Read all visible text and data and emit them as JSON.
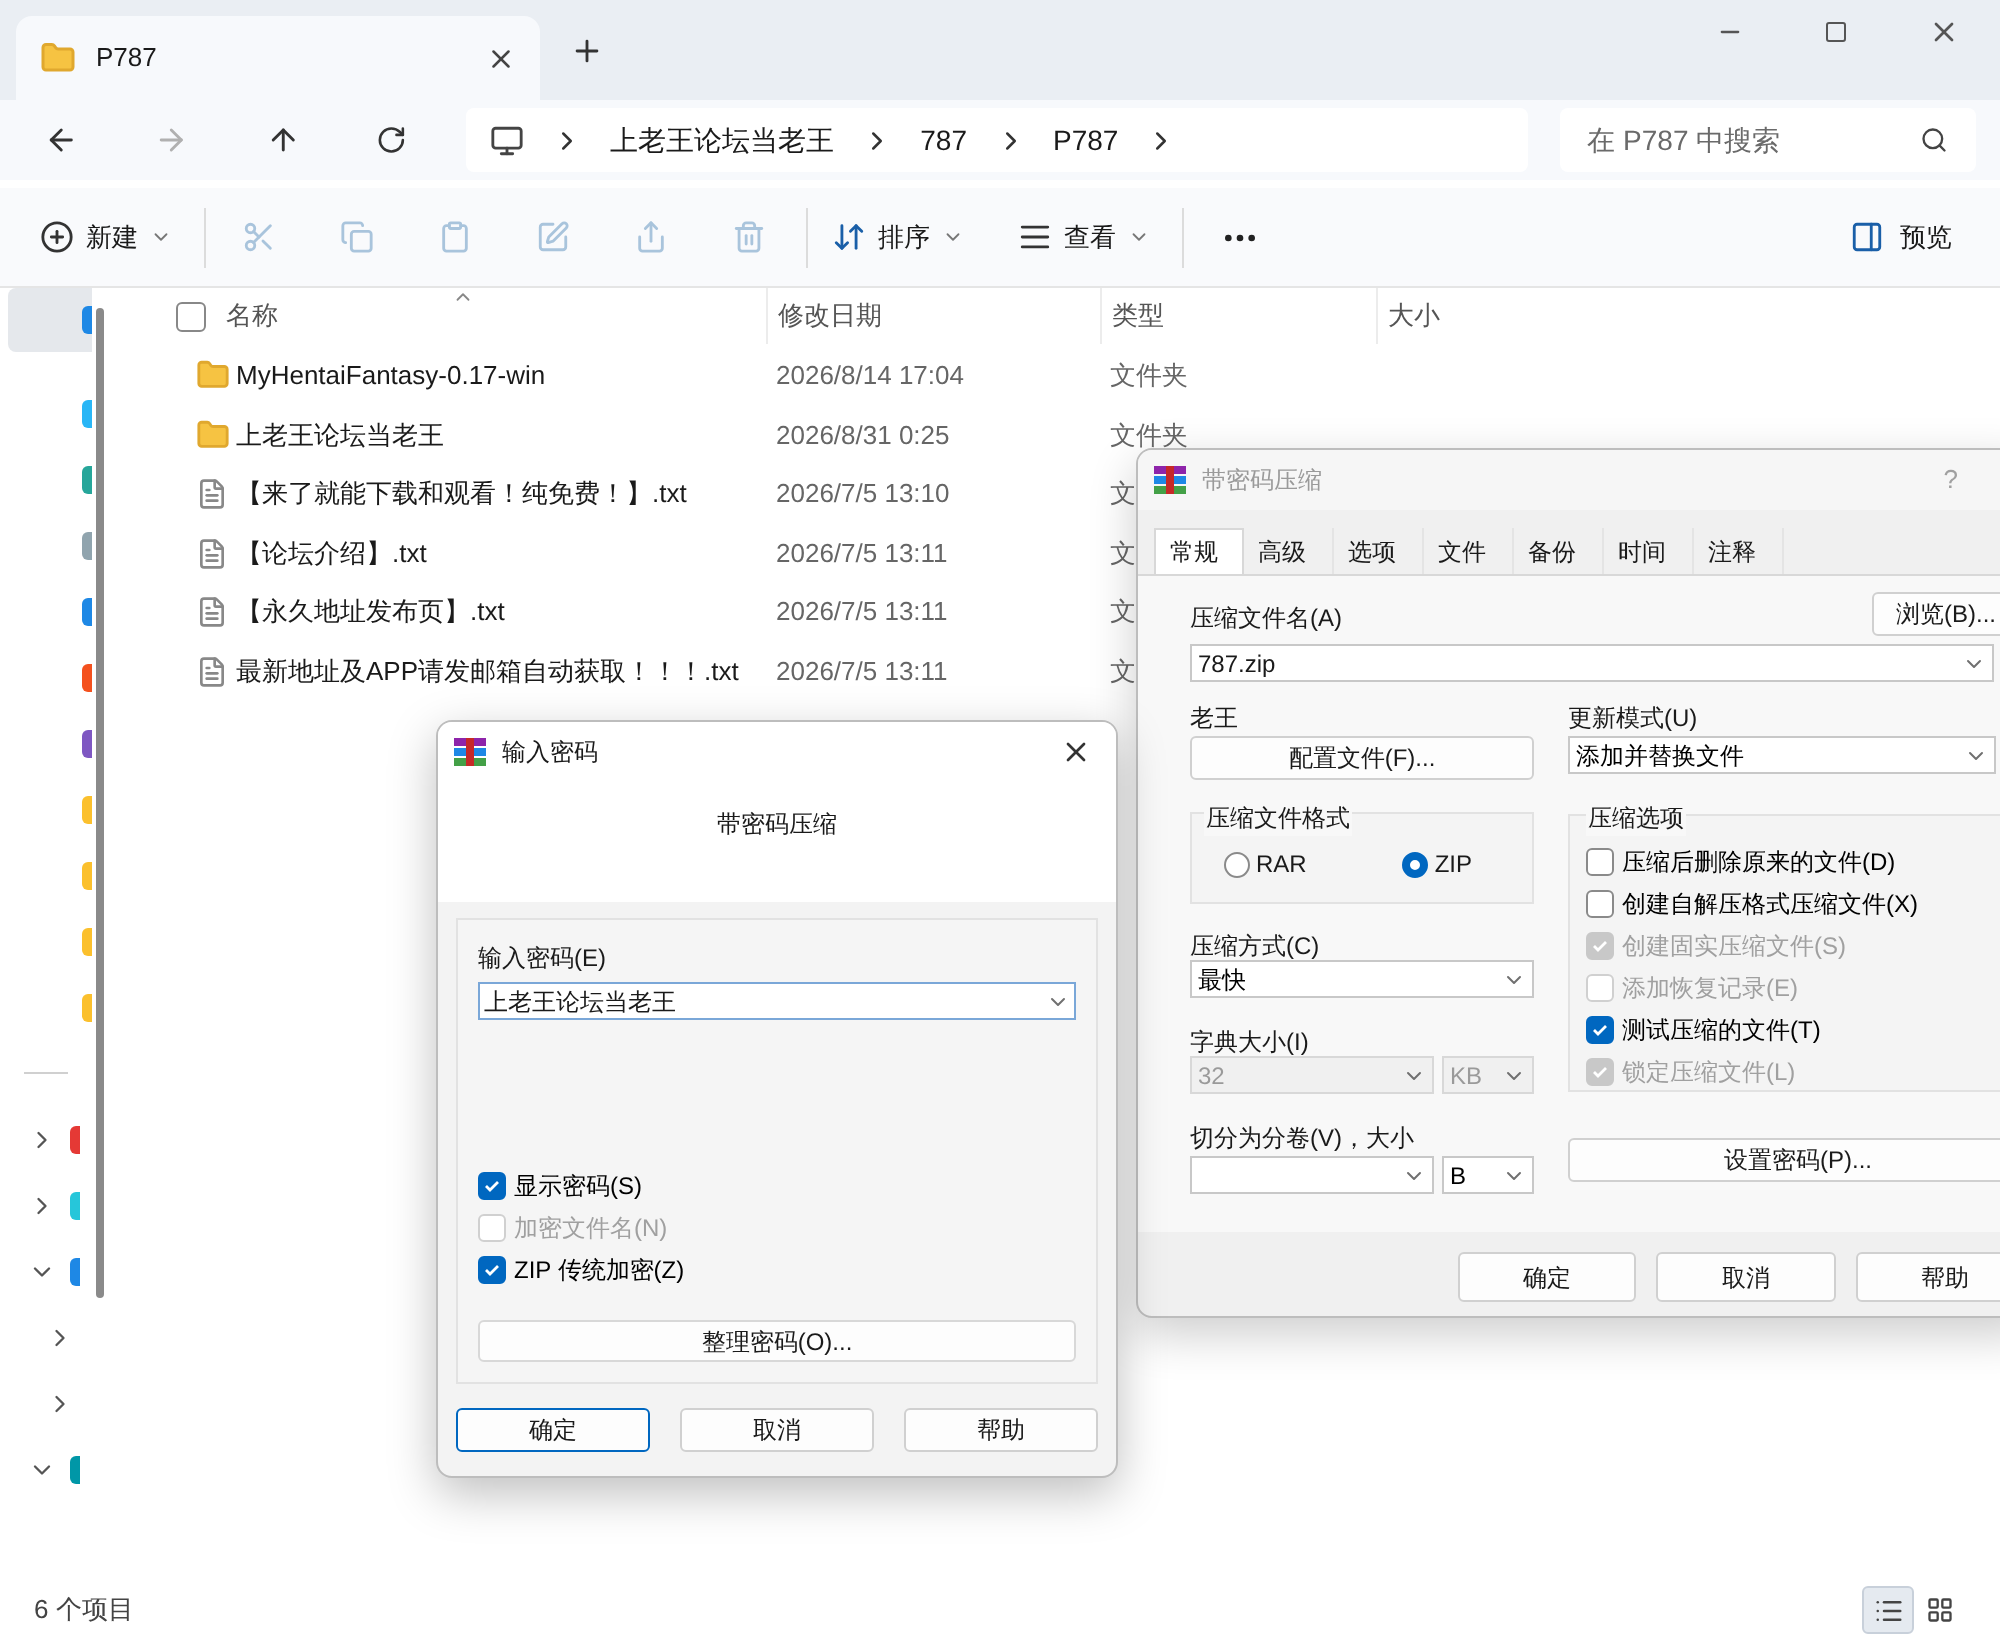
{
  "explorer": {
    "tab_title": "P787",
    "breadcrumb": [
      "上老王论坛当老王",
      "787",
      "P787"
    ],
    "search": {
      "placeholder": "在 P787 中搜索"
    },
    "toolbar": {
      "new": "新建",
      "sort": "排序",
      "view": "查看",
      "preview": "预览"
    },
    "columns": [
      "名称",
      "修改日期",
      "类型",
      "大小"
    ],
    "select_all": {
      "checked": false
    },
    "rows": [
      {
        "kind": "folder",
        "name": "MyHentaiFantasy-0.17-win",
        "date": "2026/8/14 17:04",
        "type": "文件夹"
      },
      {
        "kind": "folder",
        "name": "上老王论坛当老王",
        "date": "2026/8/31 0:25",
        "type": "文件夹"
      },
      {
        "kind": "text",
        "name": "【来了就能下载和观看！纯免费！】.txt",
        "date": "2026/7/5 13:10",
        "type": "文"
      },
      {
        "kind": "text",
        "name": "【论坛介绍】.txt",
        "date": "2026/7/5 13:11",
        "type": "文"
      },
      {
        "kind": "text",
        "name": "【永久地址发布页】.txt",
        "date": "2026/7/5 13:11",
        "type": "文"
      },
      {
        "kind": "text",
        "name": "最新地址及APP请发邮箱自动获取！！！.txt",
        "date": "2026/7/5 13:11",
        "type": "文"
      }
    ],
    "status": "6 个项目",
    "view_modes": [
      {
        "selected": true
      },
      {
        "selected": false
      }
    ]
  },
  "sidebar": {
    "quick_items": [
      {
        "selected": true
      },
      {
        "selected": false
      },
      {
        "selected": false
      },
      {
        "selected": false
      },
      {
        "selected": false
      },
      {
        "selected": false
      },
      {
        "selected": false
      },
      {
        "selected": false
      },
      {
        "selected": false
      },
      {
        "selected": false
      },
      {
        "selected": false
      }
    ],
    "tree": [
      {
        "expanded": false
      },
      {
        "expanded": false
      },
      {
        "expanded": true,
        "children": [
          {
            "expanded": false
          },
          {
            "expanded": false
          }
        ]
      },
      {
        "expanded": true
      }
    ]
  },
  "password_dialog": {
    "title": "输入密码",
    "subtitle": "带密码压缩",
    "label": "输入密码(E)",
    "value": "上老王论坛当老王",
    "options": [
      {
        "label": "显示密码(S)",
        "checked": true,
        "disabled": false
      },
      {
        "label": "加密文件名(N)",
        "checked": false,
        "disabled": true
      },
      {
        "label": "ZIP 传统加密(Z)",
        "checked": true,
        "disabled": false
      }
    ],
    "organize_button": "整理密码(O)...",
    "buttons": [
      {
        "label": "确定",
        "selected": true
      },
      {
        "label": "取消",
        "selected": false
      },
      {
        "label": "帮助",
        "selected": false
      }
    ]
  },
  "archive_dialog": {
    "title": "带密码压缩",
    "help": "?",
    "tabs": [
      {
        "label": "常规",
        "selected": true
      },
      {
        "label": "高级",
        "selected": false
      },
      {
        "label": "选项",
        "selected": false
      },
      {
        "label": "文件",
        "selected": false
      },
      {
        "label": "备份",
        "selected": false
      },
      {
        "label": "时间",
        "selected": false
      },
      {
        "label": "注释",
        "selected": false
      }
    ],
    "archive_name_label": "压缩文件名(A)",
    "browse_button": "浏览(B)...",
    "archive_name": "787.zip",
    "profile_label": "老王",
    "profile_button": "配置文件(F)...",
    "update_mode_label": "更新模式(U)",
    "update_mode": "添加并替换文件",
    "format": {
      "title": "压缩文件格式",
      "options": [
        {
          "label": "RAR",
          "selected": false
        },
        {
          "label": "ZIP",
          "selected": true
        }
      ]
    },
    "method_label": "压缩方式(C)",
    "method": "最快",
    "dict_label": "字典大小(I)",
    "dict_size": "32",
    "dict_unit": "KB",
    "dict_disabled": true,
    "split_label": "切分为分卷(V)，大小",
    "split_unit": "B",
    "options": {
      "title": "压缩选项",
      "items": [
        {
          "label": "压缩后删除原来的文件(D)",
          "checked": false,
          "disabled": false
        },
        {
          "label": "创建自解压格式压缩文件(X)",
          "checked": false,
          "disabled": false
        },
        {
          "label": "创建固实压缩文件(S)",
          "checked": true,
          "disabled": true
        },
        {
          "label": "添加恢复记录(E)",
          "checked": false,
          "disabled": true
        },
        {
          "label": "测试压缩的文件(T)",
          "checked": true,
          "disabled": false
        },
        {
          "label": "锁定压缩文件(L)",
          "checked": true,
          "disabled": true
        }
      ]
    },
    "set_password_button": "设置密码(P)...",
    "buttons": [
      {
        "label": "确定",
        "selected": false
      },
      {
        "label": "取消",
        "selected": false
      },
      {
        "label": "帮助",
        "selected": false
      }
    ]
  }
}
